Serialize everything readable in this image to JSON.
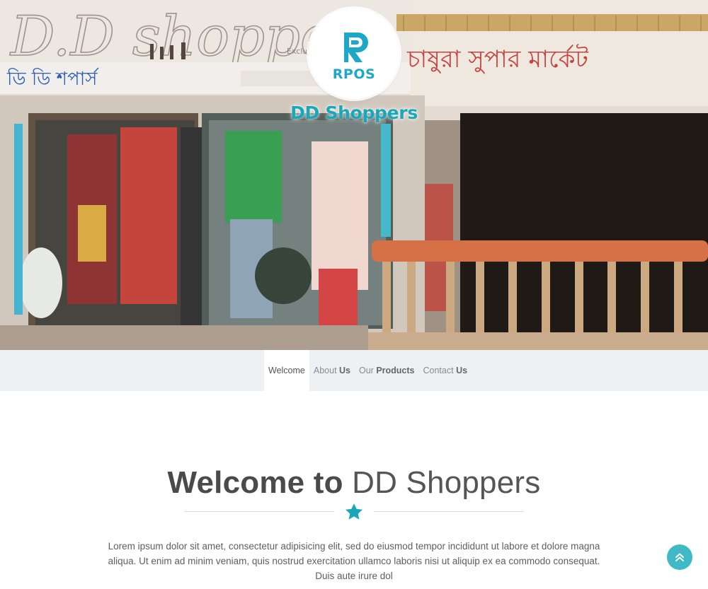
{
  "brand": {
    "logo_text": "RPOS",
    "shop_name": "DD Shoppers",
    "accent": "#1aa7b8",
    "logo_color": "#1ea8c7"
  },
  "hero": {
    "sign_left": "D.D shoppers",
    "sign_left_bangla": "ডি ডি শপার্স",
    "sign_right_bangla": "চাষুরা সুপার মার্কেট"
  },
  "nav": {
    "items": [
      {
        "light": "Welcome",
        "bold": ""
      },
      {
        "light": "About ",
        "bold": "Us"
      },
      {
        "light": "Our ",
        "bold": "Products"
      },
      {
        "light": "Contact ",
        "bold": "Us"
      }
    ],
    "active_index": 0
  },
  "welcome": {
    "title_strong": "Welcome to",
    "title_light": "DD Shoppers",
    "divider_icon": "star-icon",
    "intro": "Lorem ipsum dolor sit amet, consectetur adipisicing elit, sed do eiusmod tempor incididunt ut labore et dolore magna aliqua. Ut enim ad minim veniam, quis nostrud exercitation ullamco laboris nisi ut aliquip ex ea commodo consequat. Duis aute irure dol"
  },
  "back_to_top": {
    "icon": "double-chevron-up-icon",
    "color": "#3fb9c6"
  }
}
